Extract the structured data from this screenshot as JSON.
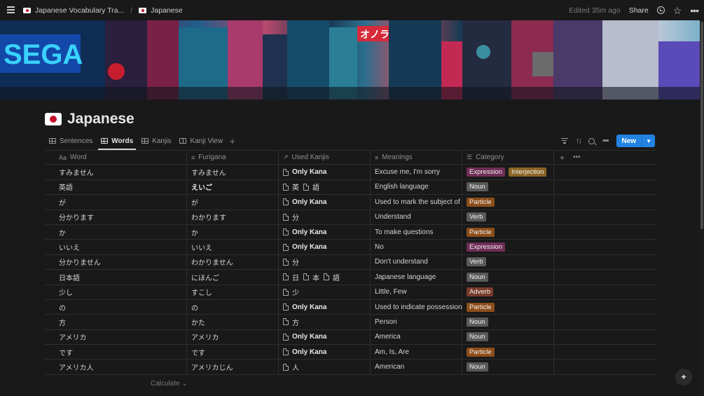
{
  "topbar": {
    "breadcrumb": [
      {
        "label": "Japanese Vocabulary Tra..."
      },
      {
        "label": "Japanese"
      }
    ],
    "separator": "/",
    "edited": "Edited 35m ago",
    "share": "Share"
  },
  "page": {
    "title": "Japanese"
  },
  "views": [
    {
      "label": "Sentences",
      "icon": "table-icon"
    },
    {
      "label": "Words",
      "icon": "table-icon"
    },
    {
      "label": "Kanjis",
      "icon": "table-icon"
    },
    {
      "label": "Kanji View",
      "icon": "board-icon"
    }
  ],
  "toolbar": {
    "new_label": "New"
  },
  "columns": {
    "word": "Word",
    "word_prefix": "Aa",
    "furigana": "Furigana",
    "used_kanjis": "Used Kanjis",
    "meanings": "Meanings",
    "category": "Category"
  },
  "tag_colors": {
    "Expression": "#6f2d57",
    "Interjection": "#8a6424",
    "Noun": "#5a5a5a",
    "Particle": "#8c4d1a",
    "Verb": "#5a5a5a",
    "Adverb": "#7a3b2a"
  },
  "rows": [
    {
      "word": "すみません",
      "furigana": "すみません",
      "kanjis": [
        "Only Kana"
      ],
      "meaning": "Excuse me, I'm sorry",
      "tags": [
        "Expression",
        "Interjection"
      ]
    },
    {
      "word": "英語",
      "furigana": "えいご",
      "furi_bold": true,
      "kanjis": [
        "英",
        "語"
      ],
      "meaning": "English language",
      "tags": [
        "Noun"
      ]
    },
    {
      "word": "が",
      "furigana": "が",
      "kanjis": [
        "Only Kana"
      ],
      "meaning": "Used to mark the subject of a s",
      "tags": [
        "Particle"
      ]
    },
    {
      "word": "分かります",
      "furigana": "わかります",
      "kanjis": [
        "分"
      ],
      "meaning": "Understand",
      "tags": [
        "Verb"
      ]
    },
    {
      "word": "か",
      "furigana": "か",
      "kanjis": [
        "Only Kana"
      ],
      "meaning": "To make questions",
      "tags": [
        "Particle"
      ]
    },
    {
      "word": "いいえ",
      "furigana": "いいえ",
      "kanjis": [
        "Only Kana"
      ],
      "meaning": "No",
      "tags": [
        "Expression"
      ]
    },
    {
      "word": "分かりません",
      "furigana": "わかりません",
      "kanjis": [
        "分"
      ],
      "meaning": "Don't understand",
      "tags": [
        "Verb"
      ]
    },
    {
      "word": "日本語",
      "furigana": "にほんご",
      "kanjis": [
        "日",
        "本",
        "語"
      ],
      "meaning": "Japanese language",
      "tags": [
        "Noun"
      ]
    },
    {
      "word": "少し",
      "furigana": "すこし",
      "kanjis": [
        "少"
      ],
      "meaning": "Little, Few",
      "tags": [
        "Adverb"
      ]
    },
    {
      "word": "の",
      "furigana": "の",
      "kanjis": [
        "Only Kana"
      ],
      "meaning": "Used to indicate possession, as",
      "tags": [
        "Particle"
      ]
    },
    {
      "word": "方",
      "furigana": "かた",
      "kanjis": [
        "方"
      ],
      "meaning": "Person",
      "tags": [
        "Noun"
      ]
    },
    {
      "word": "アメリカ",
      "furigana": "アメリカ",
      "kanjis": [
        "Only Kana"
      ],
      "meaning": "America",
      "tags": [
        "Noun"
      ]
    },
    {
      "word": "です",
      "furigana": "です",
      "kanjis": [
        "Only Kana"
      ],
      "meaning": "Am, Is, Are",
      "tags": [
        "Particle"
      ]
    },
    {
      "word": "アメリカ人",
      "furigana": "アメリカじん",
      "kanjis": [
        "人"
      ],
      "meaning": "American",
      "tags": [
        "Noun"
      ]
    }
  ],
  "footer": {
    "calculate": "Calculate ⌄"
  }
}
